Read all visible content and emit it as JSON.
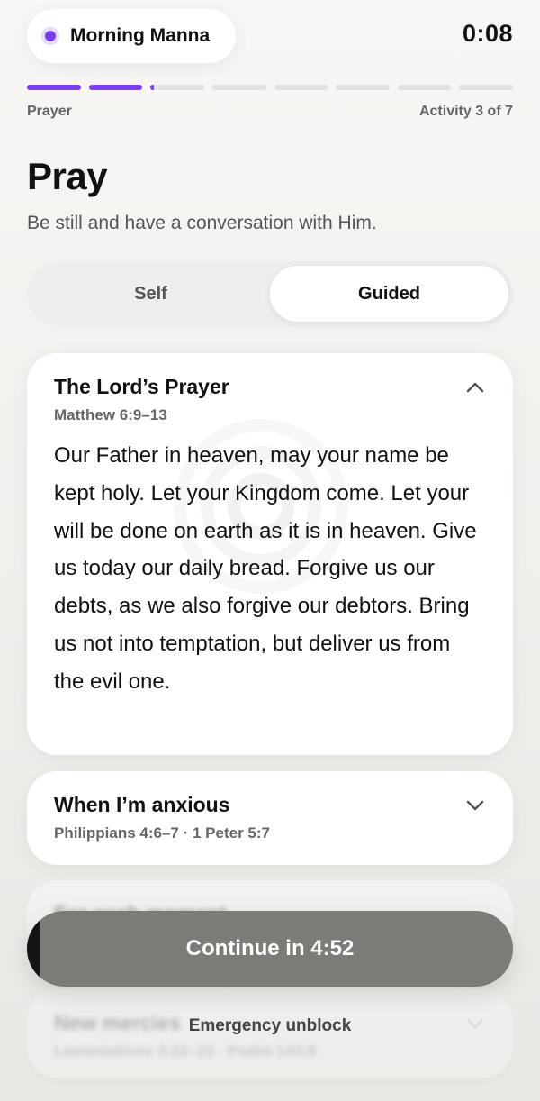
{
  "header": {
    "app_name": "Morning Manna",
    "timer": "0:08",
    "accent_color": "#7b3ff2"
  },
  "progress": {
    "total_steps": 8,
    "completed_steps": 2,
    "step_label": "Prayer",
    "activity_label": "Activity 3 of 7"
  },
  "page": {
    "title": "Pray",
    "subtitle": "Be still and have a conversation with Him."
  },
  "mode_toggle": {
    "options": [
      "Self",
      "Guided"
    ],
    "selected": "Guided"
  },
  "prayers": [
    {
      "title": "The Lord’s Prayer",
      "reference": "Matthew 6:9–13",
      "expanded": true,
      "body": "Our Father in heaven, may your name be kept holy. Let your Kingdom come. Let your will be done on earth as it is in heaven. Give us today our daily bread. Forgive us our debts, as we also forgive our debtors. Bring us not into temptation, but deliver us from the evil one.",
      "icon": "chevron-up-icon"
    },
    {
      "title": "When I’m anxious",
      "reference": "Philippians 4:6–7 · 1 Peter 5:7",
      "expanded": false,
      "icon": "chevron-down-icon"
    },
    {
      "title": "For each moment",
      "reference": "",
      "expanded": false
    },
    {
      "title": "New mercies",
      "reference": "Lamentations 3:22–23 · Psalm 143:8",
      "expanded": false,
      "icon": "chevron-down-icon"
    }
  ],
  "footer": {
    "continue_label": "Continue in 4:52",
    "continue_progress": 0.025,
    "emergency_label": "Emergency unblock"
  }
}
